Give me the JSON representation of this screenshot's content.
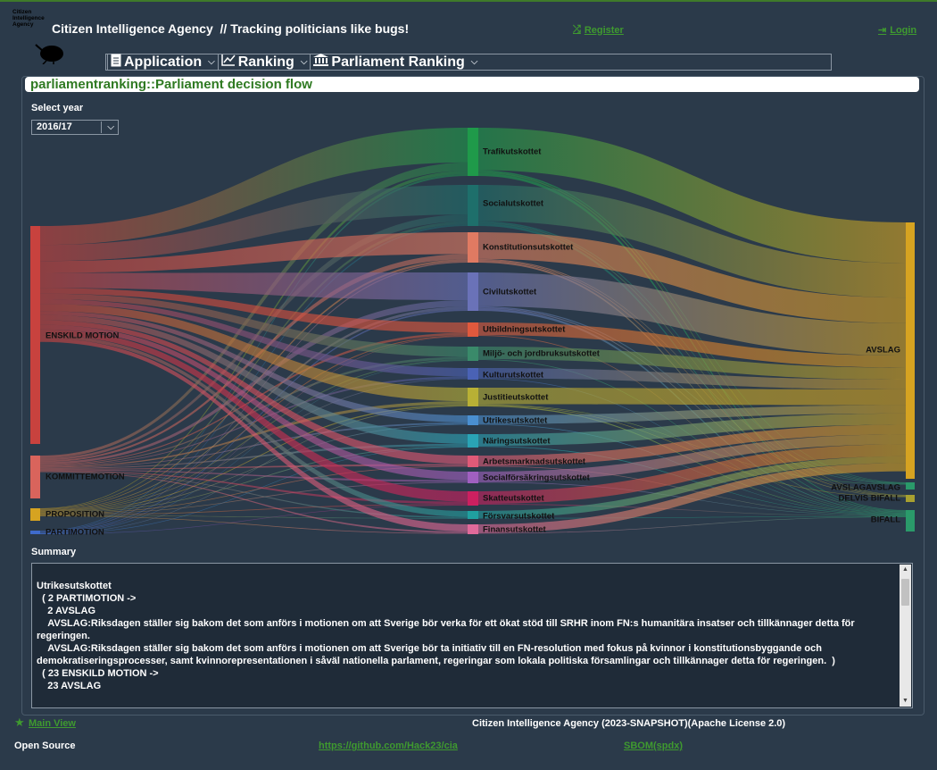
{
  "header": {
    "logo_text": [
      "Citizen",
      "Intelligence",
      "Agency"
    ],
    "title": "Citizen Intelligence Agency  // Tracking politicians like bugs!",
    "register_label": "Register",
    "login_label": "Login"
  },
  "menu": {
    "items": [
      {
        "label": "Application",
        "icon": "document-icon"
      },
      {
        "label": "Ranking",
        "icon": "chart-line-icon"
      },
      {
        "label": "Parliament Ranking",
        "icon": "parliament-building-icon"
      }
    ]
  },
  "page": {
    "title": "parliamentranking::Parliament decision flow",
    "select_year_label": "Select year",
    "selected_year": "2016/17",
    "summary_label": "Summary"
  },
  "chart_data": {
    "type": "sankey",
    "sources": [
      {
        "name": "ENSKILD MOTION",
        "color": "#c8423e"
      },
      {
        "name": "KOMMITTEMOTION",
        "color": "#d9645c"
      },
      {
        "name": "PROPOSITION",
        "color": "#d6a321"
      },
      {
        "name": "PARTIMOTION",
        "color": "#3f6bcc"
      }
    ],
    "committees": [
      {
        "name": "Trafikutskottet",
        "color": "#1f9a4a"
      },
      {
        "name": "Socialutskottet",
        "color": "#1e6f6b"
      },
      {
        "name": "Konstitutionsutskottet",
        "color": "#e07a62"
      },
      {
        "name": "Civilutskottet",
        "color": "#6a72b8"
      },
      {
        "name": "Utbildningsutskottet",
        "color": "#e0593d"
      },
      {
        "name": "Miljö- och jordbruksutskottet",
        "color": "#3a8a6a"
      },
      {
        "name": "Kulturutskottet",
        "color": "#4a62b5"
      },
      {
        "name": "Justitieutskottet",
        "color": "#b8b035"
      },
      {
        "name": "Utrikesutskottet",
        "color": "#4a8fd0"
      },
      {
        "name": "Näringsutskottet",
        "color": "#2aa3b5"
      },
      {
        "name": "Arbetsmarknadsutskottet",
        "color": "#e05a78"
      },
      {
        "name": "Socialförsäkringsutskottet",
        "color": "#a060c0"
      },
      {
        "name": "Skatteutskottet",
        "color": "#cc2060"
      },
      {
        "name": "Försvarsutskottet",
        "color": "#20a0a0"
      },
      {
        "name": "Finansutskottet",
        "color": "#e06a9a"
      }
    ],
    "outcomes": [
      {
        "name": "AVSLAG",
        "color": "#d6a321"
      },
      {
        "name": "AVSLAGAVSLAG",
        "color": "#2a9a6a"
      },
      {
        "name": "DELVIS BIFALL",
        "color": "#a8a030"
      },
      {
        "name": "BIFALL",
        "color": "#2a9a6a"
      }
    ]
  },
  "summary": {
    "text": "Utrikesutskottet\n  ( 2 PARTIMOTION ->\n    2 AVSLAG\n    AVSLAG:Riksdagen ställer sig bakom det som anförs i motionen om att Sverige bör verka för ett ökat stöd till SRHR inom FN:s humanitära insatser och tillkännager detta för regeringen.\n    AVSLAG:Riksdagen ställer sig bakom det som anförs i motionen om att Sverige bör ta initiativ till en FN-resolution med fokus på kvinnor i konstitutionsbyggande och demokratiseringsprocesser, samt kvinnorepresentationen i såväl nationella parlament, regeringar som lokala politiska församlingar och tillkännager detta för regeringen.  )\n  ( 23 ENSKILD MOTION ->\n    23 AVSLAG"
  },
  "footer": {
    "main_view_label": "Main View",
    "version_text": "Citizen Intelligence Agency (2023-SNAPSHOT)(Apache License 2.0)",
    "open_source_label": "Open Source",
    "github_link": "https://github.com/Hack23/cia",
    "sbom_link": "SBOM(spdx)"
  }
}
